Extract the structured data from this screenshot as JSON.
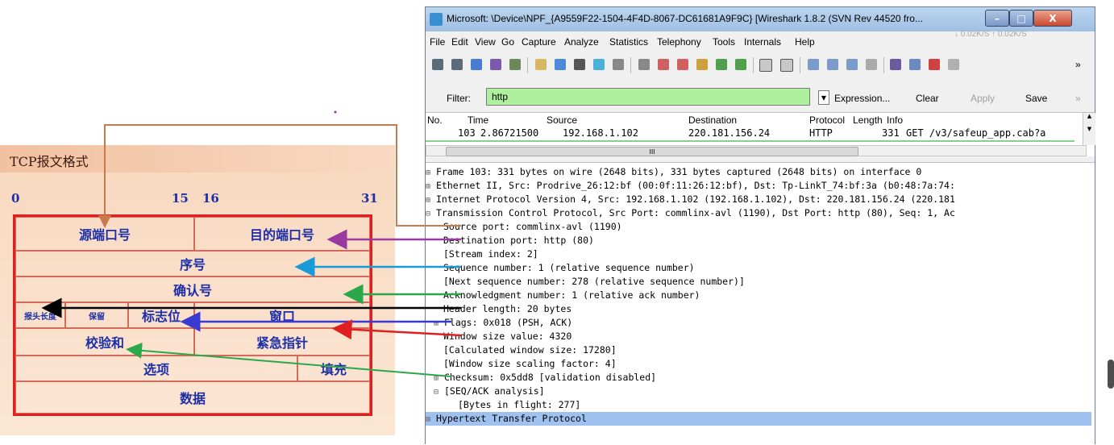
{
  "tcp_diagram": {
    "title": "TCP报文格式",
    "bit_numbers": [
      "0",
      "15",
      "16",
      "31"
    ],
    "fields": {
      "src_port": "源端口号",
      "dst_port": "目的端口号",
      "seq": "序号",
      "ack": "确认号",
      "header_len": "报头长度",
      "reserved": "保留",
      "flags": "标志位",
      "window": "窗口",
      "checksum": "校验和",
      "urgent": "紧急指针",
      "options": "选项",
      "padding": "填充",
      "data": "数据"
    }
  },
  "wireshark": {
    "title": "Microsoft: \\Device\\NPF_{A9559F22-1504-4F4D-8067-DC61681A9F9C}  [Wireshark 1.8.2  (SVN Rev 44520 fro...",
    "net_rate": "↓ 0.02K/S  ↑ 0.02K/S",
    "window_buttons": {
      "minimize": "–",
      "maximize": "□",
      "close": "X"
    },
    "menu": [
      "File",
      "Edit",
      "View",
      "Go",
      "Capture",
      "Analyze",
      "Statistics",
      "Telephony",
      "Tools",
      "Internals",
      "Help"
    ],
    "filter": {
      "label": "Filter:",
      "value": "http",
      "buttons": {
        "expression": "Expression...",
        "clear": "Clear",
        "apply": "Apply",
        "save": "Save",
        "more": "»"
      }
    },
    "packet_list": {
      "headers": [
        "No.",
        "Time",
        "Source",
        "Destination",
        "Protocol",
        "Length",
        "Info"
      ],
      "row": {
        "no": "103",
        "time": "2.86721500",
        "source": "192.168.1.102",
        "destination": "220.181.156.24",
        "protocol": "HTTP",
        "length": "331",
        "info": "GET /v3/safeup_app.cab?a"
      },
      "hscroll_label": "III"
    },
    "details": [
      {
        "prefix": "⊞",
        "text": "Frame 103: 331 bytes on wire (2648 bits), 331 bytes captured (2648 bits) on interface 0"
      },
      {
        "prefix": "⊞",
        "text": "Ethernet II, Src: Prodrive_26:12:bf (00:0f:11:26:12:bf), Dst: Tp-LinkT_74:bf:3a (b0:48:7a:74:"
      },
      {
        "prefix": "⊞",
        "text": "Internet Protocol Version 4, Src: 192.168.1.102 (192.168.1.102), Dst: 220.181.156.24 (220.181"
      },
      {
        "prefix": "⊟",
        "text": "Transmission Control Protocol, Src Port: commlinx-avl (1190), Dst Port: http (80), Seq: 1, Ac"
      },
      {
        "prefix": "",
        "text": "Source port: commlinx-avl (1190)"
      },
      {
        "prefix": "",
        "text": "Destination port: http (80)"
      },
      {
        "prefix": "",
        "text": "[Stream index: 2]"
      },
      {
        "prefix": "",
        "text": "Sequence number: 1    (relative sequence number)"
      },
      {
        "prefix": "",
        "text": "[Next sequence number: 278    (relative sequence number)]"
      },
      {
        "prefix": "",
        "text": "Acknowledgment number: 1    (relative ack number)"
      },
      {
        "prefix": "",
        "text": "Header length: 20 bytes"
      },
      {
        "prefix": "⊞",
        "text": "Flags: 0x018 (PSH, ACK)"
      },
      {
        "prefix": "",
        "text": "Window size value: 4320"
      },
      {
        "prefix": "",
        "text": "[Calculated window size: 17280]"
      },
      {
        "prefix": "",
        "text": "[Window size scaling factor: 4]"
      },
      {
        "prefix": "⊞",
        "text": "Checksum: 0x5dd8 [validation disabled]"
      },
      {
        "prefix": "⊟",
        "text": "[SEQ/ACK analysis]"
      },
      {
        "prefix": "",
        "text": "[Bytes in flight: 277]"
      },
      {
        "prefix": "⊞",
        "text": "Hypertext Transfer Protocol"
      }
    ]
  },
  "colors": {
    "filter_bg": "#aff09f",
    "selected_row": "#9ec1f0",
    "diagram_border": "#e02020",
    "diagram_text": "#1c2fa8"
  }
}
